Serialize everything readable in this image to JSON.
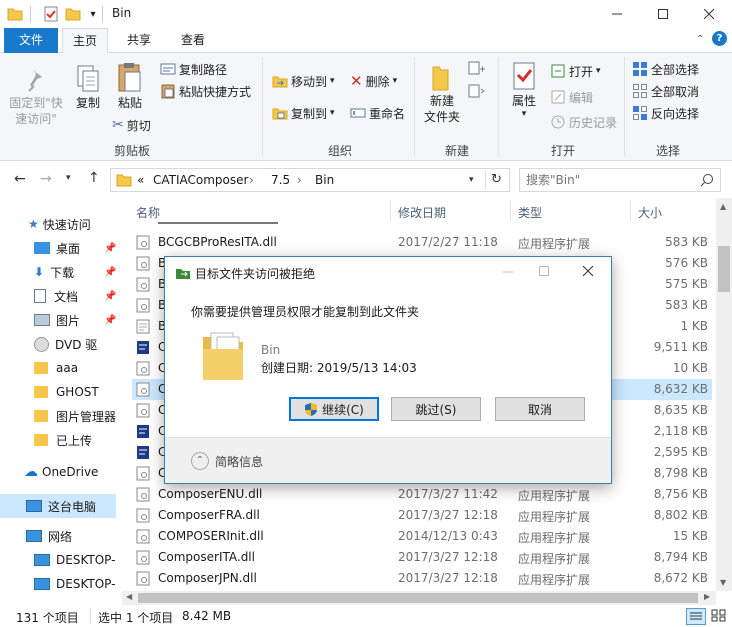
{
  "window": {
    "title": "Bin"
  },
  "tabs": {
    "file": "文件",
    "home": "主页",
    "share": "共享",
    "view": "查看"
  },
  "ribbon": {
    "clipboard": {
      "group": "剪贴板",
      "pin": "固定到\"快\n速访问\"",
      "copy": "复制",
      "paste": "粘贴",
      "copy_path": "复制路径",
      "paste_shortcut": "粘贴快捷方式",
      "cut": "剪切"
    },
    "organize": {
      "group": "组织",
      "move_to": "移动到",
      "copy_to": "复制到",
      "delete": "删除",
      "rename": "重命名"
    },
    "new": {
      "group": "新建",
      "new_folder": "新建\n文件夹"
    },
    "open": {
      "group": "打开",
      "properties": "属性",
      "open": "打开",
      "edit": "编辑",
      "history": "历史记录"
    },
    "select": {
      "group": "选择",
      "select_all": "全部选择",
      "select_none": "全部取消",
      "invert": "反向选择"
    }
  },
  "address": {
    "chevrons": "«",
    "crumbs": [
      "CATIAComposer",
      "7.5",
      "Bin"
    ],
    "search_placeholder": "搜索\"Bin\""
  },
  "nav": {
    "items": [
      {
        "label": "快速访问",
        "icon": "star-icon"
      },
      {
        "label": "桌面",
        "icon": "desktop-icon"
      },
      {
        "label": "下载",
        "icon": "download-icon"
      },
      {
        "label": "文档",
        "icon": "document-icon"
      },
      {
        "label": "图片",
        "icon": "picture-icon"
      },
      {
        "label": "DVD 驱",
        "icon": "dvd-icon"
      },
      {
        "label": "aaa",
        "icon": "folder-icon"
      },
      {
        "label": "GHOST",
        "icon": "folder-icon"
      },
      {
        "label": "图片管理器",
        "icon": "folder-icon"
      },
      {
        "label": "已上传",
        "icon": "folder-icon"
      },
      {
        "label": "OneDrive",
        "icon": "cloud-icon"
      },
      {
        "label": "这台电脑",
        "icon": "computer-icon"
      },
      {
        "label": "网络",
        "icon": "network-icon"
      },
      {
        "label": "DESKTOP-",
        "icon": "computer-icon"
      },
      {
        "label": "DESKTOP-",
        "icon": "computer-icon"
      }
    ]
  },
  "columns": {
    "name": "名称",
    "date": "修改日期",
    "type": "类型",
    "size": "大小"
  },
  "files": [
    {
      "name": "BCGCBProResITA.dll",
      "date": "2017/2/27 11:18",
      "type": "应用程序扩展",
      "size": "583 KB"
    },
    {
      "name": "B",
      "date": "",
      "type": "",
      "size": "576 KB"
    },
    {
      "name": "B",
      "date": "",
      "type": "",
      "size": "575 KB"
    },
    {
      "name": "B",
      "date": "",
      "type": "",
      "size": "583 KB"
    },
    {
      "name": "B",
      "date": "",
      "type": "",
      "size": "1 KB"
    },
    {
      "name": "C",
      "date": "",
      "type": "",
      "size": "9,511 KB"
    },
    {
      "name": "C",
      "date": "",
      "type": "",
      "size": "10 KB"
    },
    {
      "name": "C",
      "date": "",
      "type": "",
      "size": "8,632 KB"
    },
    {
      "name": "C",
      "date": "",
      "type": "",
      "size": "8,635 KB"
    },
    {
      "name": "C",
      "date": "",
      "type": "",
      "size": "2,118 KB"
    },
    {
      "name": "C",
      "date": "",
      "type": "",
      "size": "2,595 KB"
    },
    {
      "name": "C",
      "date": "",
      "type": "",
      "size": "8,798 KB"
    },
    {
      "name": "ComposerENU.dll",
      "date": "2017/3/27 11:42",
      "type": "应用程序扩展",
      "size": "8,756 KB"
    },
    {
      "name": "ComposerFRA.dll",
      "date": "2017/3/27 12:18",
      "type": "应用程序扩展",
      "size": "8,802 KB"
    },
    {
      "name": "COMPOSERInit.dll",
      "date": "2014/12/13 0:43",
      "type": "应用程序扩展",
      "size": "15 KB"
    },
    {
      "name": "ComposerITA.dll",
      "date": "2017/3/27 12:18",
      "type": "应用程序扩展",
      "size": "8,794 KB"
    },
    {
      "name": "ComposerJPN.dll",
      "date": "2017/3/27 12:18",
      "type": "应用程序扩展",
      "size": "8,672 KB"
    }
  ],
  "status": {
    "count": "131 个项目",
    "selected": "选中 1 个项目",
    "size": "8.42 MB"
  },
  "dialog": {
    "title": "目标文件夹访问被拒绝",
    "message": "你需要提供管理员权限才能复制到此文件夹",
    "folder_name": "Bin",
    "created": "创建日期: 2019/5/13 14:03",
    "continue": "继续(C)",
    "skip": "跳过(S)",
    "cancel": "取消",
    "details": "简略信息"
  },
  "colors": {
    "accent": "#1979ca",
    "selection": "#cce8ff"
  }
}
